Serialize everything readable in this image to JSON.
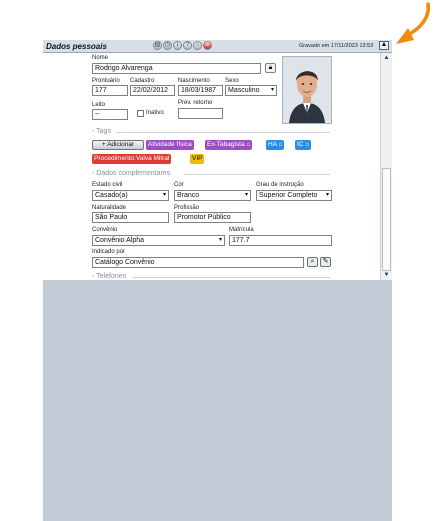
{
  "window": {
    "title": "Dados pessoais",
    "saved_status": "Gravado em 17/11/2023 13:53",
    "toolbar_icons": [
      "print-icon",
      "history-icon",
      "info-icon",
      "help-icon",
      "search-icon",
      "delete-icon"
    ]
  },
  "personal": {
    "nome_label": "Nome",
    "nome_value": "Rodrigo Alvarenga",
    "prontuario_label": "Prontuário",
    "prontuario_value": "177",
    "cadastro_label": "Cadastro",
    "cadastro_value": "22/02/2012",
    "nascimento_label": "Nascimento",
    "nascimento_value": "18/03/1987",
    "sexo_label": "Sexo",
    "sexo_value": "Masculino",
    "leito_label": "Leito",
    "leito_value": "--",
    "inativo_label": "Inativo",
    "prev_retorno_label": "Prev. retorno",
    "prev_retorno_value": ""
  },
  "tags": {
    "section_label": "Tags",
    "add_label": "+ Adicionar",
    "items": [
      {
        "label": "Atividade física",
        "color": "#9b4fc1"
      },
      {
        "label": "Ex-Tabagista",
        "color": "#9b4fc1",
        "locked": true
      },
      {
        "label": "HA",
        "color": "#2a8de0",
        "locked": true
      },
      {
        "label": "IC",
        "color": "#2a8de0",
        "locked": true
      },
      {
        "label": "Procedimento:Valva Mitral",
        "color": "#e03c33"
      },
      {
        "label": "VIP",
        "color": "#f2b900"
      }
    ]
  },
  "complementares": {
    "section_label": "Dados complementares",
    "estado_civil_label": "Estado civil",
    "estado_civil_value": "Casado(a)",
    "cor_label": "Cor",
    "cor_value": "Branco",
    "grau_label": "Grau de instrução",
    "grau_value": "Superior Completo",
    "naturalidade_label": "Naturalidade",
    "naturalidade_value": "São Paulo",
    "profissao_label": "Profissão",
    "profissao_value": "Promotor Público",
    "convenio_label": "Convênio",
    "convenio_value": "Convênio Alpha",
    "matricula_label": "Matrícula",
    "matricula_value": "177.7",
    "indicado_label": "Indicado por",
    "indicado_value": "Catálogo Convênio"
  },
  "telefones": {
    "section_label": "Telefones"
  },
  "colors": {
    "accent_arrow": "#f08a0c"
  }
}
